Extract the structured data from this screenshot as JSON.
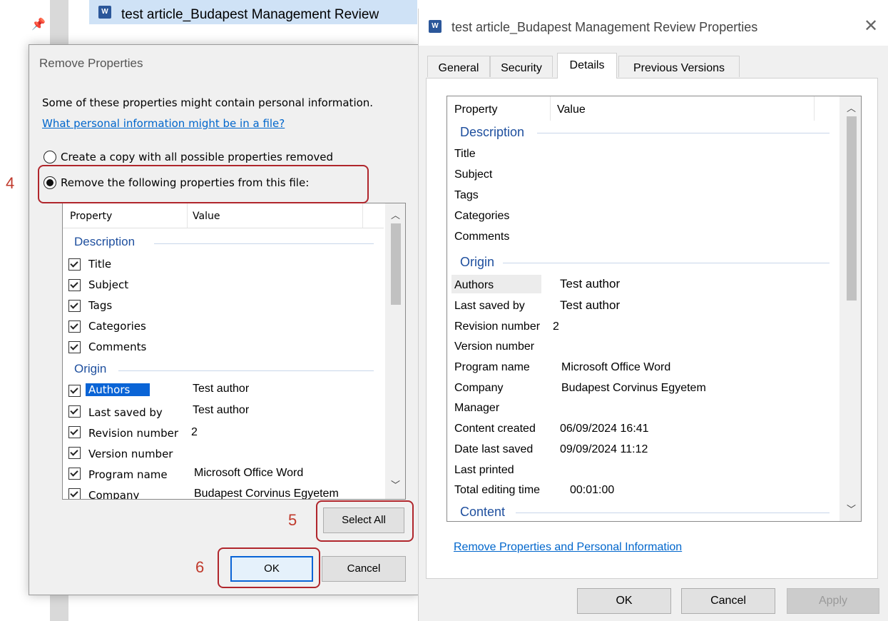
{
  "background": {
    "file_title": "test article_Budapest Management Review",
    "word_icon_text": "W"
  },
  "remove_dialog": {
    "title": "Remove Properties",
    "info_text": "Some of these properties might contain personal information.",
    "info_link": "What personal information might be in a file?",
    "option_copy": "Create a copy with all possible properties removed",
    "option_remove": "Remove the following properties from this file:",
    "selected_option": "remove",
    "columns": {
      "property": "Property",
      "value": "Value"
    },
    "section_description": "Description",
    "description_items": [
      "Title",
      "Subject",
      "Tags",
      "Categories",
      "Comments"
    ],
    "section_origin": "Origin",
    "origin_items": [
      {
        "name": "Authors",
        "value": "Test author"
      },
      {
        "name": "Last saved by",
        "value": "Test author"
      },
      {
        "name": "Revision number",
        "value": "2"
      },
      {
        "name": "Version number",
        "value": ""
      },
      {
        "name": "Program name",
        "value": "Microsoft Office Word"
      },
      {
        "name": "Company",
        "value": "Budapest Corvinus Egyetem"
      }
    ],
    "select_all_label": "Select All",
    "ok_label": "OK",
    "cancel_label": "Cancel"
  },
  "annotations": {
    "step4": "4",
    "step5": "5",
    "step6": "6"
  },
  "properties_dialog": {
    "title": "test article_Budapest Management Review Properties",
    "close_glyph": "✕",
    "tabs": [
      "General",
      "Security",
      "Details",
      "Previous Versions"
    ],
    "active_tab": "Details",
    "columns": {
      "property": "Property",
      "value": "Value"
    },
    "section_description": "Description",
    "description_items": [
      "Title",
      "Subject",
      "Tags",
      "Categories",
      "Comments"
    ],
    "section_origin": "Origin",
    "origin_items": [
      {
        "name": "Authors",
        "value": "Test author"
      },
      {
        "name": "Last saved by",
        "value": "Test author"
      },
      {
        "name": "Revision number",
        "value": "2"
      },
      {
        "name": "Version number",
        "value": ""
      },
      {
        "name": "Program name",
        "value": "Microsoft Office Word"
      },
      {
        "name": "Company",
        "value": "Budapest Corvinus Egyetem"
      },
      {
        "name": "Manager",
        "value": ""
      },
      {
        "name": "Content created",
        "value": "06/09/2024 16:41"
      },
      {
        "name": "Date last saved",
        "value": "09/09/2024 11:12"
      },
      {
        "name": "Last printed",
        "value": ""
      },
      {
        "name": "Total editing time",
        "value": "00:01:00"
      }
    ],
    "section_content": "Content",
    "remove_link": "Remove Properties and Personal Information",
    "ok_label": "OK",
    "cancel_label": "Cancel",
    "apply_label": "Apply"
  },
  "colors": {
    "accent": "#0a64d6",
    "annotation": "#b0262c",
    "link": "#0066cc"
  }
}
